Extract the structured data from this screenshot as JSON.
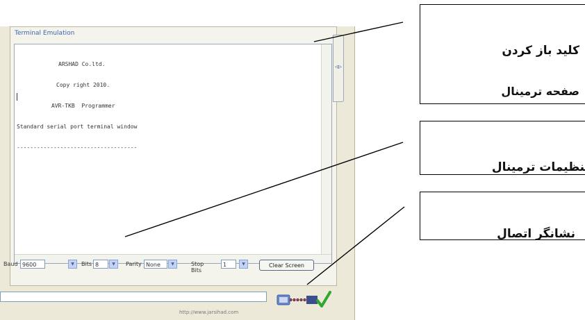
{
  "panel": {
    "title": "Terminal Emulation",
    "terminal_lines": [
      "ARSHAD Co.ltd.",
      "Copy right 2010.",
      "AVR-TKB  Programmer",
      "Standard serial port terminal window",
      "------------------------------------"
    ]
  },
  "controls": {
    "baud_label": "Baud",
    "baud_value": "9600",
    "bits_label": "Bits",
    "bits_value": "8",
    "parity_label": "Parity",
    "parity_value": "None",
    "stop_label": "Stop Bits",
    "stop_value": "1",
    "clear_button": "Clear Screen"
  },
  "status": {
    "url": "http://www.jarsihad.com"
  },
  "callouts": [
    {
      "line1": "کلید باز کردن",
      "line2": "صفحه ترمینال"
    },
    {
      "line1": "تنظیمات ترمینال"
    },
    {
      "line1": "نشانگر اتصال"
    }
  ],
  "colors": {
    "window_bg": "#ece9d8",
    "panel_title": "#3b66b0",
    "connect_ok": "#2fa82f"
  },
  "icons": {
    "side_tab": "chevron-icon",
    "connection": "connection-indicator-icon"
  }
}
